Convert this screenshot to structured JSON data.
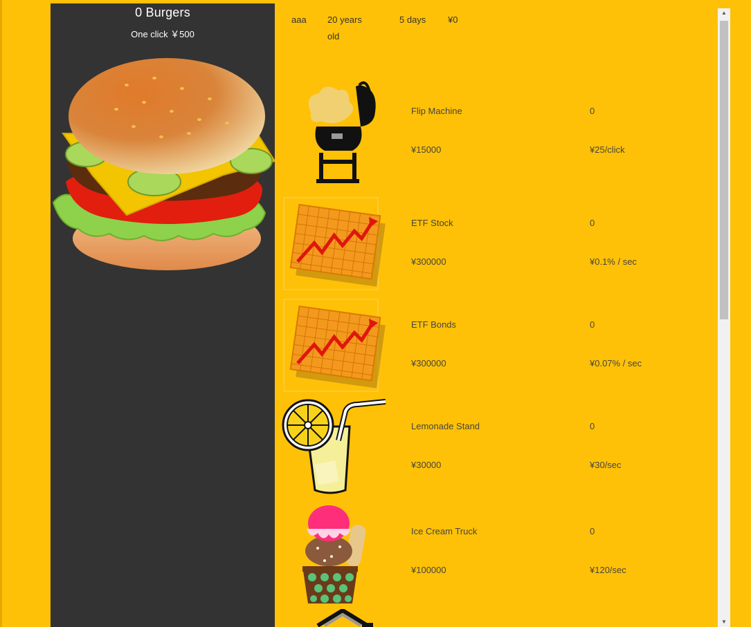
{
  "burger_panel": {
    "count_label": "0 Burgers",
    "click_label": "One click ￥500"
  },
  "stats": {
    "name": "aaa",
    "age": "20 years old",
    "days": "5 days",
    "money": "¥0"
  },
  "items": [
    {
      "name": "Flip Machine",
      "owned": "0",
      "price": "¥15000",
      "rate": "¥25/click",
      "icon": "grill-icon"
    },
    {
      "name": "ETF Stock",
      "owned": "0",
      "price": "¥300000",
      "rate": "¥0.1% / sec",
      "icon": "rising-chart-icon"
    },
    {
      "name": "ETF Bonds",
      "owned": "0",
      "price": "¥300000",
      "rate": "¥0.07% / sec",
      "icon": "rising-chart-icon"
    },
    {
      "name": "Lemonade Stand",
      "owned": "0",
      "price": "¥30000",
      "rate": "¥30/sec",
      "icon": "lemonade-icon"
    },
    {
      "name": "Ice Cream Truck",
      "owned": "0",
      "price": "¥100000",
      "rate": "¥120/sec",
      "icon": "ice-cream-icon"
    }
  ],
  "colors": {
    "background": "#ffc107",
    "panel": "#333333",
    "text": "#444444"
  }
}
